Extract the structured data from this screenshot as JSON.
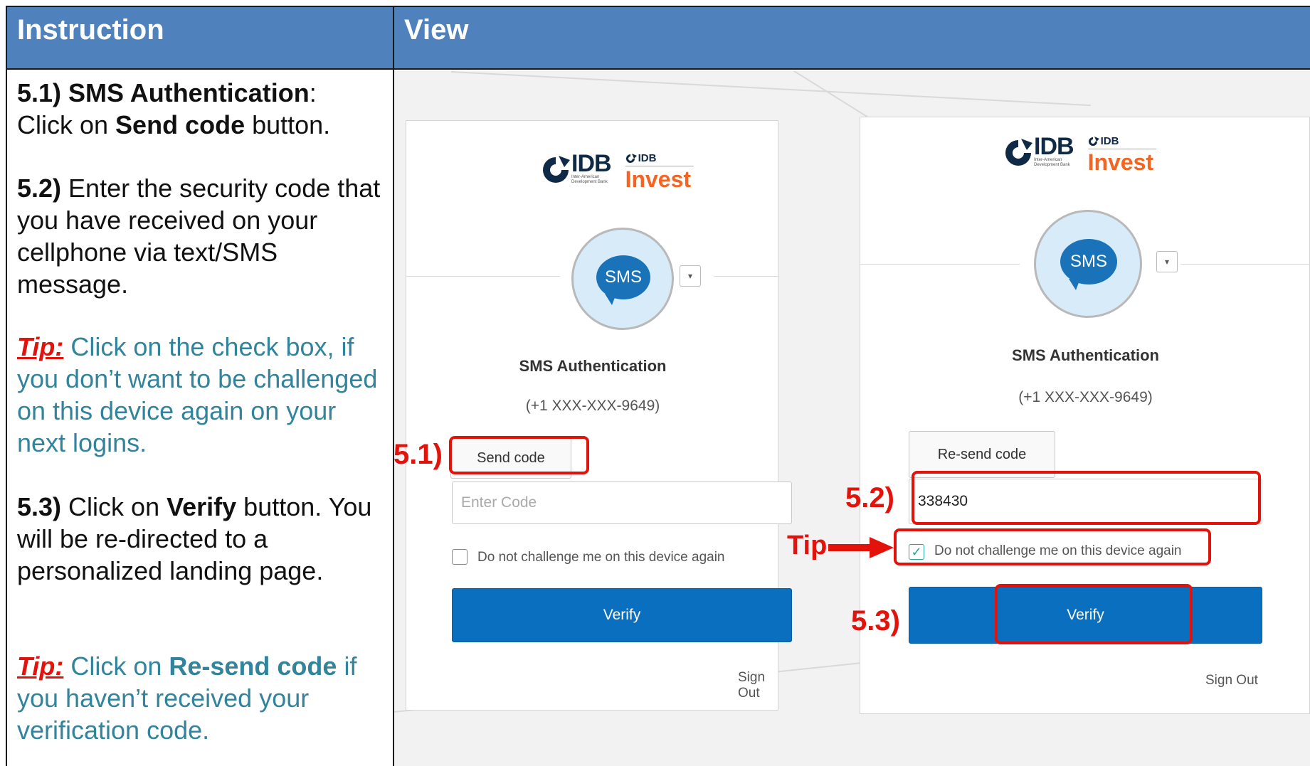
{
  "header": {
    "instruction_label": "Instruction",
    "view_label": "View"
  },
  "instructions": {
    "s51": {
      "num": "5.1)  SMS Authentication",
      "colon": ":",
      "line2_pre": "Click on ",
      "line2_bold": "Send code",
      "line2_post": " button."
    },
    "s52": {
      "num": "5.2)",
      "text": " Enter the security code that you have received on your cellphone via text/SMS message."
    },
    "tip1": {
      "label": "Tip:",
      "text": " Click on the check box, if you don’t want to be challenged on this device again on your next logins."
    },
    "s53": {
      "num": "5.3)",
      "pre": " Click on ",
      "bold": "Verify",
      "post": " button. You will be re-directed to a personalized landing page."
    },
    "tip2": {
      "label": "Tip:",
      "pre": " Click on ",
      "bold": "Re-send code",
      "post": " if you haven’t received your verification code."
    }
  },
  "logo": {
    "idb": "IDB",
    "idb_sub1": "Inter-American",
    "idb_sub2": "Development Bank",
    "idb_small": "IDB",
    "invest": "Invest"
  },
  "left_panel": {
    "sms_icon": "SMS",
    "title": "SMS Authentication",
    "phone": "(+1 XXX-XXX-9649)",
    "send_button": "Send code",
    "code_placeholder": "Enter Code",
    "code_value": "",
    "checkbox_label": "Do not challenge me on this device again",
    "checkbox_checked": false,
    "verify": "Verify",
    "sign_out": "Sign Out"
  },
  "right_panel": {
    "sms_icon": "SMS",
    "title": "SMS Authentication",
    "phone": "(+1 XXX-XXX-9649)",
    "resend_button": "Re-send code",
    "code_value": "338430",
    "checkbox_label": "Do not challenge me on this device again",
    "checkbox_checked": true,
    "verify": "Verify",
    "sign_out": "Sign Out"
  },
  "callouts": {
    "s51": "5.1)",
    "s52": "5.2)",
    "s53": "5.3)",
    "tip": "Tip"
  },
  "colors": {
    "header": "#4f81bd",
    "annotation": "#e3120b",
    "tip_text": "#31849b",
    "verify": "#0a6fbe"
  }
}
